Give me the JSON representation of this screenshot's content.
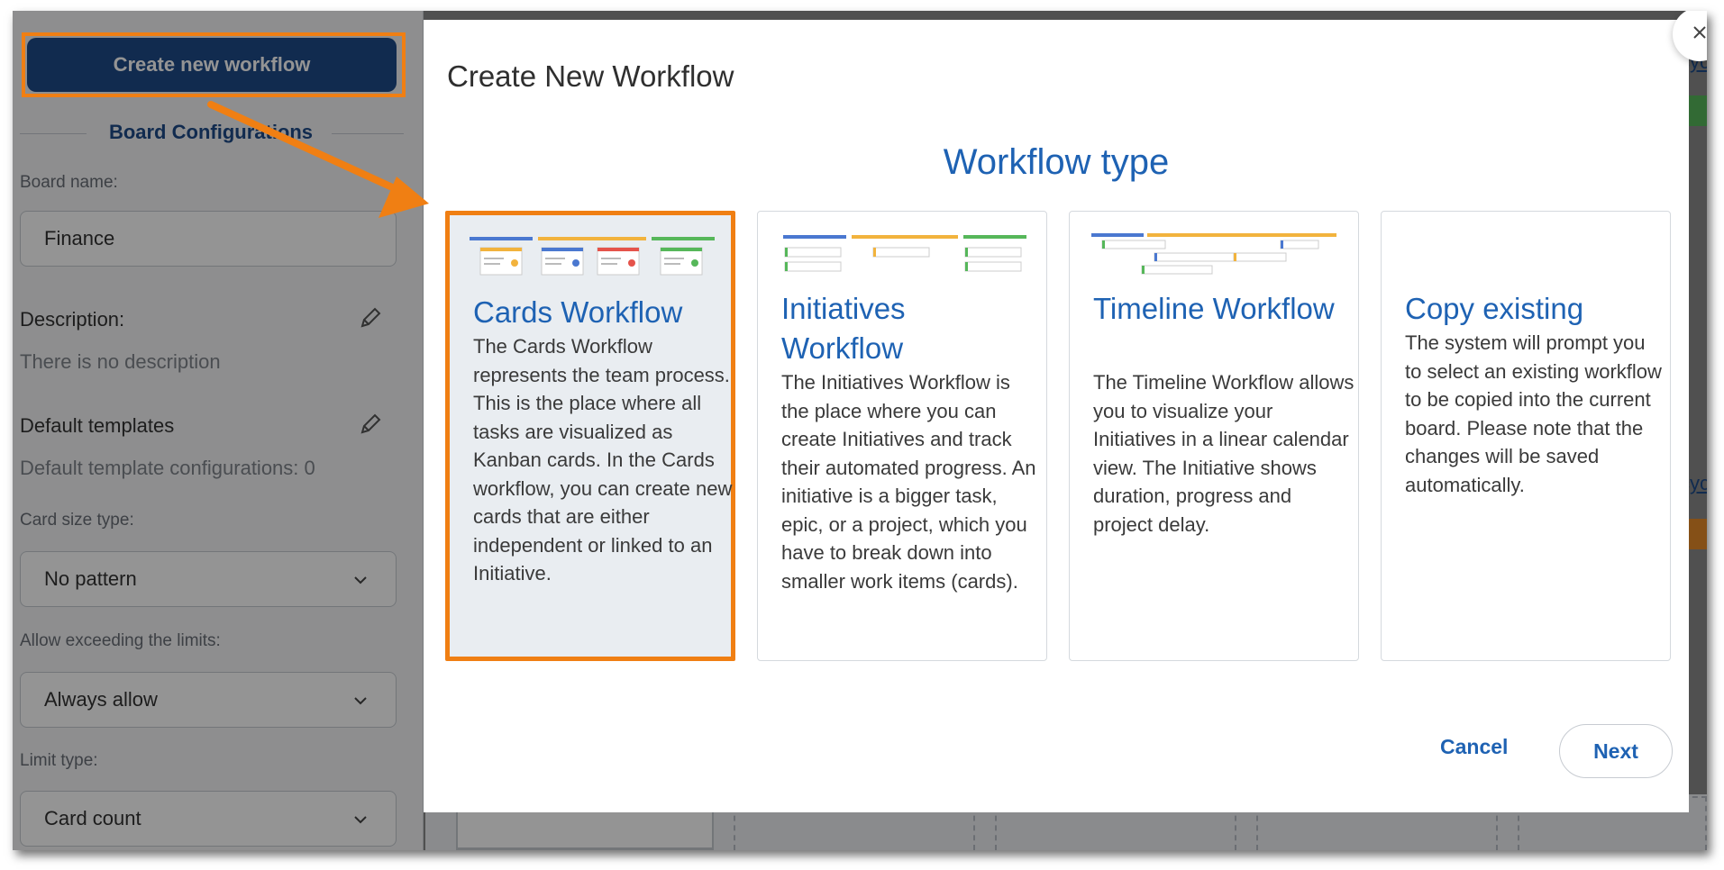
{
  "sidebar": {
    "create_button": "Create new workflow",
    "section_title": "Board Configurations",
    "board_name_label": "Board name:",
    "board_name_value": "Finance",
    "description_label": "Description:",
    "description_value": "There is no description",
    "default_templates_label": "Default templates",
    "default_templates_value": "Default template configurations: 0",
    "card_size_label": "Card size type:",
    "card_size_value": "No pattern",
    "exceeding_label": "Allow exceeding the limits:",
    "exceeding_value": "Always allow",
    "limit_type_label": "Limit type:",
    "limit_type_value": "Card count"
  },
  "background": {
    "link_fragment_top": "cycl",
    "link_fragment_mid": "cycl"
  },
  "modal": {
    "title": "Create New Workflow",
    "section_heading": "Workflow type",
    "cards": [
      {
        "title": "Cards Workflow",
        "description": "The Cards Workflow represents the team process. This is the place where all tasks are visualized as Kanban cards. In the Cards workflow, you can create new cards that are either independent or linked to an Initiative.",
        "selected": true
      },
      {
        "title": "Initiatives Workflow",
        "description": "The Initiatives Workflow is the place where you can create Initiatives and track their automated progress. An initiative is a bigger task, epic, or a project, which you have to break down into smaller work items (cards).",
        "selected": false
      },
      {
        "title": "Timeline Workflow",
        "description": "The Timeline Workflow allows you to visualize your Initiatives in a linear calendar view. The Initiative shows duration, progress and project delay.",
        "selected": false
      },
      {
        "title": "Copy existing",
        "description": "The system will prompt you to select an existing workflow to be copied into the current board. Please note that the changes will be saved automatically.",
        "selected": false
      }
    ],
    "cancel_label": "Cancel",
    "next_label": "Next"
  },
  "colors": {
    "accent_blue": "#1e62b3",
    "button_navy": "#1e4b88",
    "highlight_orange": "#f07f13",
    "lane_blue": "#4a78d0",
    "lane_yellow": "#f2b33d",
    "lane_red": "#e5534b",
    "lane_green": "#56b75a"
  },
  "icons": [
    "close-icon",
    "pencil-icon",
    "chevron-down-icon",
    "annotation-arrow"
  ]
}
